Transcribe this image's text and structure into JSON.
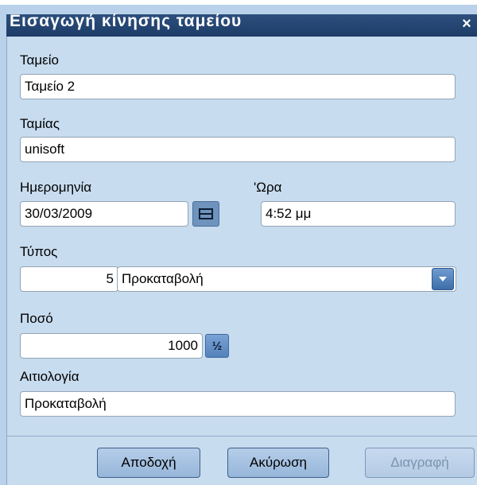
{
  "window": {
    "title": "Εισαγωγή κίνησης ταμείου",
    "close_glyph": "×"
  },
  "form": {
    "cashbox": {
      "label": "Ταμείο",
      "value": "Ταμείο 2"
    },
    "cashier": {
      "label": "Ταμίας",
      "value": "unisoft"
    },
    "date": {
      "label": "Ημερομηνία",
      "value": "30/03/2009",
      "button_icon": "calendar-icon"
    },
    "time": {
      "label": "'Ωρα",
      "value": "4:52 μμ"
    },
    "type": {
      "label": "Τύπος",
      "code": "5",
      "description": "Προκαταβολή",
      "button_icon": "chevron-down-icon"
    },
    "amount": {
      "label": "Ποσό",
      "value": "1000",
      "button_glyph": "½",
      "button_icon": "fraction-icon"
    },
    "reason": {
      "label": "Αιτιολογία",
      "value": "Προκαταβολή"
    }
  },
  "buttons": {
    "accept": "Αποδοχή",
    "cancel": "Ακύρωση",
    "delete": "Διαγραφή"
  },
  "colors": {
    "titlebar": "#1d3c68",
    "client_background": "#c8dcef",
    "disabled_text": "#7d93ad"
  }
}
